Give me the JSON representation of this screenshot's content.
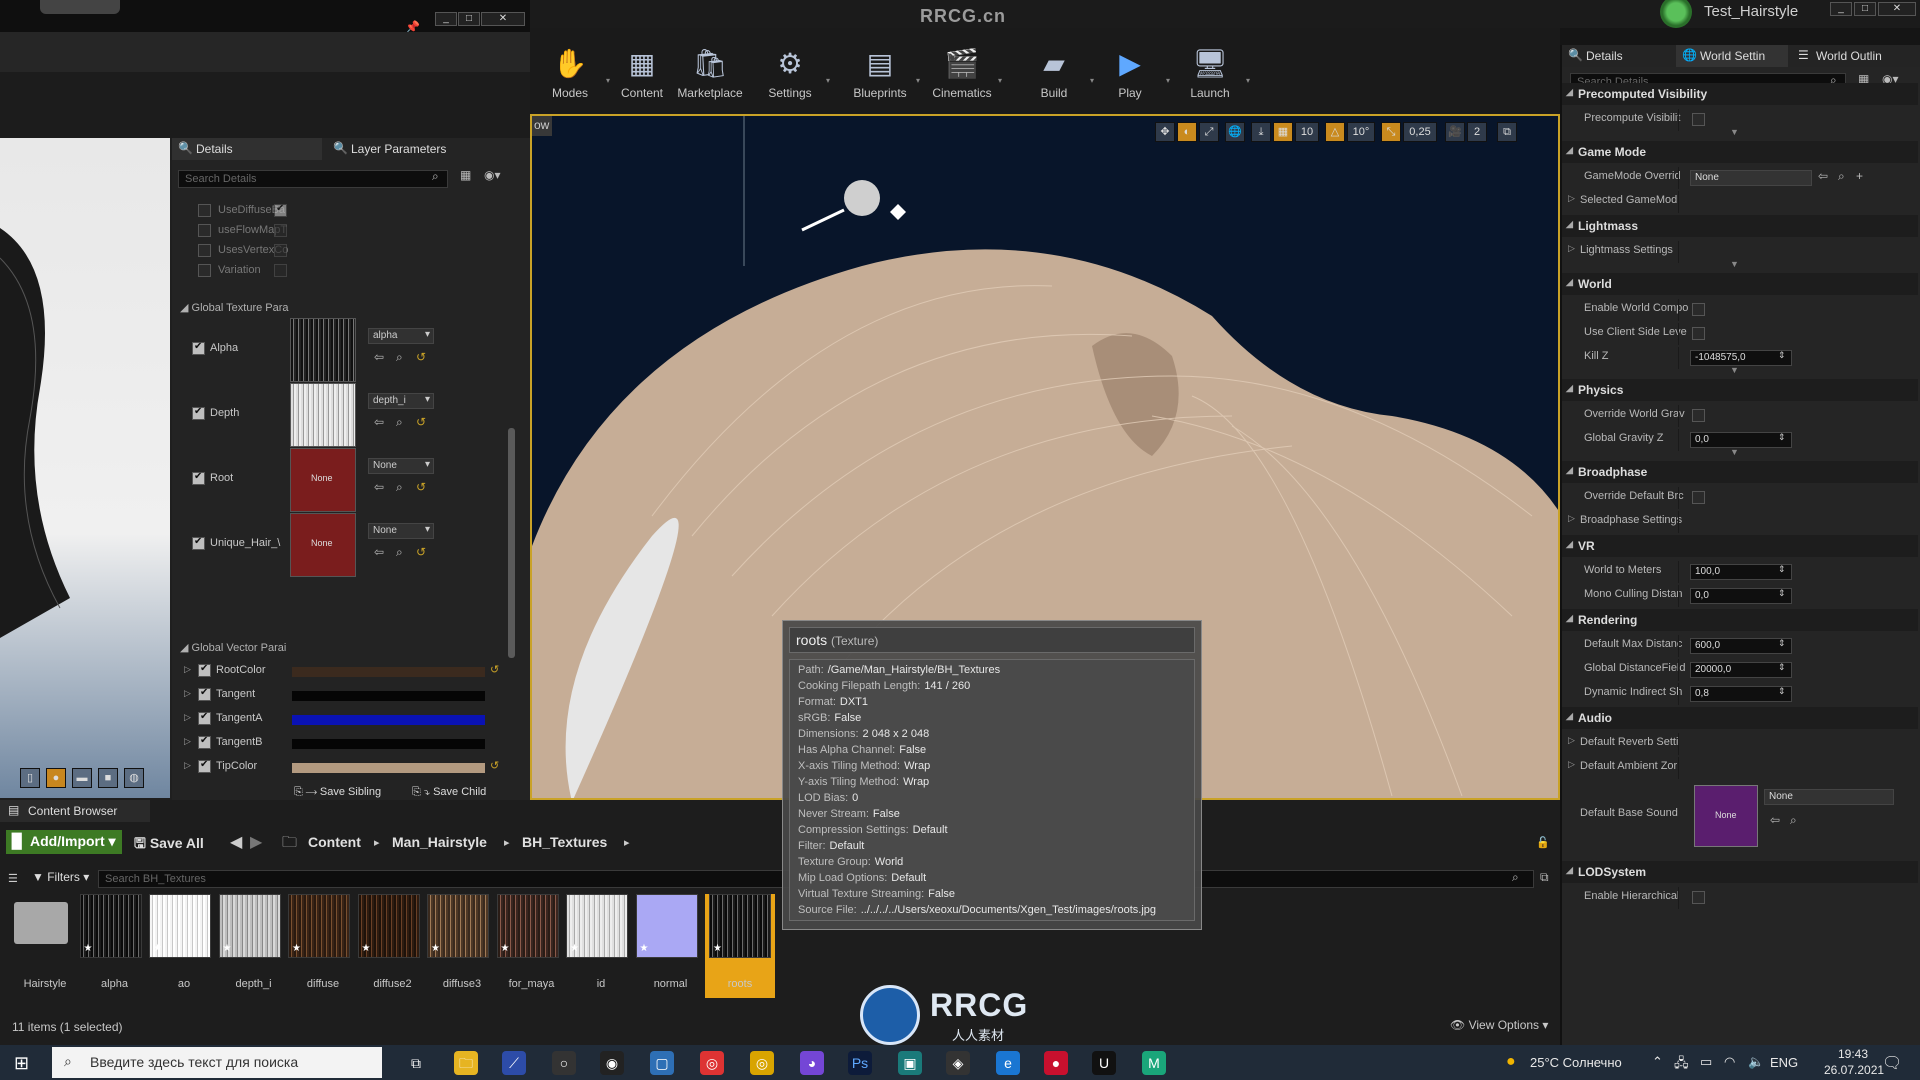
{
  "window": {
    "brand": "RRCG.cn",
    "project_name": "Test_Hairstyle"
  },
  "toolbar": {
    "buttons": [
      {
        "label": "Modes"
      },
      {
        "label": "Content"
      },
      {
        "label": "Marketplace"
      },
      {
        "label": "Settings"
      },
      {
        "label": "Blueprints"
      },
      {
        "label": "Cinematics"
      },
      {
        "label": "Build"
      },
      {
        "label": "Play"
      },
      {
        "label": "Launch"
      }
    ]
  },
  "viewport": {
    "corner_label": "ow",
    "grid_snap": "10",
    "rotation_snap": "10°",
    "scale_snap": "0,25",
    "camera_speed": "2"
  },
  "left_panel": {
    "tabs": [
      "Details",
      "Layer Parameters"
    ],
    "search_placeholder": "Search Details",
    "static_switches": [
      {
        "label": "UseDiffuseBa",
        "checked": true
      },
      {
        "label": "useFlowMapT",
        "checked": false
      },
      {
        "label": "UsesVertexCo",
        "checked": false
      },
      {
        "label": "Variation",
        "checked": false
      }
    ],
    "texture_group_label": "Global Texture Para",
    "textures": [
      {
        "label": "Alpha",
        "value": "alpha",
        "thumb": "hair-dark"
      },
      {
        "label": "Depth",
        "value": "depth_i",
        "thumb": "hair-light"
      },
      {
        "label": "Root",
        "value": "None",
        "thumb": "none"
      },
      {
        "label": "Unique_Hair_\\",
        "value": "None",
        "thumb": "none"
      }
    ],
    "none_label": "None",
    "vector_group_label": "Global Vector Parai",
    "vectors": [
      {
        "label": "RootColor",
        "color": "#3b2a1e"
      },
      {
        "label": "Tangent",
        "color": "#050505"
      },
      {
        "label": "TangentA",
        "color": "#0a12b4"
      },
      {
        "label": "TangentB",
        "color": "#050505"
      },
      {
        "label": "TipColor",
        "color": "#b39a80"
      }
    ],
    "save_sibling": "Save Sibling",
    "save_child": "Save Child"
  },
  "right_panel": {
    "tabs": [
      "Details",
      "World Settin",
      "World Outlin"
    ],
    "search_placeholder": "Search Details",
    "sections": [
      {
        "title": "Precomputed Visibility",
        "props": [
          {
            "label": "Precompute Visibilit",
            "kind": "check"
          }
        ]
      },
      {
        "title": "Game Mode",
        "props": [
          {
            "label": "GameMode Overrid",
            "kind": "select",
            "value": "None"
          },
          {
            "label": "Selected GameMod",
            "kind": "expand"
          }
        ]
      },
      {
        "title": "Lightmass",
        "props": [
          {
            "label": "Lightmass Settings",
            "kind": "expand"
          }
        ]
      },
      {
        "title": "World",
        "props": [
          {
            "label": "Enable World Compo",
            "kind": "check"
          },
          {
            "label": "Use Client Side Leve",
            "kind": "check"
          },
          {
            "label": "Kill Z",
            "kind": "num",
            "value": "-1048575,0"
          }
        ]
      },
      {
        "title": "Physics",
        "props": [
          {
            "label": "Override World Grav",
            "kind": "check"
          },
          {
            "label": "Global Gravity Z",
            "kind": "num",
            "value": "0,0"
          }
        ]
      },
      {
        "title": "Broadphase",
        "props": [
          {
            "label": "Override Default Brc",
            "kind": "check"
          },
          {
            "label": "Broadphase Settings",
            "kind": "expand"
          }
        ]
      },
      {
        "title": "VR",
        "props": [
          {
            "label": "World to Meters",
            "kind": "num",
            "value": "100,0"
          },
          {
            "label": "Mono Culling Distan",
            "kind": "num",
            "value": "0,0"
          }
        ]
      },
      {
        "title": "Rendering",
        "props": [
          {
            "label": "Default Max Distanc",
            "kind": "num",
            "value": "600,0"
          },
          {
            "label": "Global DistanceField",
            "kind": "num",
            "value": "20000,0"
          },
          {
            "label": "Dynamic Indirect Sh",
            "kind": "num",
            "value": "0,8"
          }
        ]
      },
      {
        "title": "Audio",
        "props": [
          {
            "label": "Default Reverb Setti",
            "kind": "expand"
          },
          {
            "label": "Default Ambient Zor",
            "kind": "expand"
          }
        ]
      },
      {
        "title": "LODSystem",
        "props": [
          {
            "label": "Enable Hierarchical",
            "kind": "check"
          }
        ]
      }
    ],
    "base_sound_label": "Default Base Sound",
    "base_sound_value": "None",
    "base_sound_thumb": "None"
  },
  "content_browser": {
    "tab": "Content Browser",
    "add_import": "Add/Import",
    "save_all": "Save All",
    "breadcrumb": [
      "Content",
      "Man_Hairstyle",
      "BH_Textures"
    ],
    "filters": "Filters",
    "search_placeholder": "Search BH_Textures",
    "assets": [
      {
        "name": "Hairstyle",
        "kind": "folder"
      },
      {
        "name": "alpha",
        "kind": "dark"
      },
      {
        "name": "ao",
        "kind": "white"
      },
      {
        "name": "depth_i",
        "kind": "light"
      },
      {
        "name": "diffuse",
        "kind": "brown"
      },
      {
        "name": "diffuse2",
        "kind": "brown2"
      },
      {
        "name": "diffuse3",
        "kind": "brown3"
      },
      {
        "name": "for_maya",
        "kind": "brown4"
      },
      {
        "name": "id",
        "kind": "grey"
      },
      {
        "name": "normal",
        "kind": "normal"
      },
      {
        "name": "roots",
        "kind": "dark",
        "selected": true
      }
    ],
    "status": "11 items (1 selected)",
    "view_options": "View Options"
  },
  "tooltip": {
    "title": "roots",
    "type": "(Texture)",
    "rows": [
      {
        "k": "Path:",
        "v": "/Game/Man_Hairstyle/BH_Textures"
      },
      {
        "k": "Cooking Filepath Length:",
        "v": "141 / 260"
      },
      {
        "k": "Format:",
        "v": "DXT1"
      },
      {
        "k": "sRGB:",
        "v": "False"
      },
      {
        "k": "Dimensions:",
        "v": "2 048 x 2 048"
      },
      {
        "k": "Has Alpha Channel:",
        "v": "False"
      },
      {
        "k": "X-axis Tiling Method:",
        "v": "Wrap"
      },
      {
        "k": "Y-axis Tiling Method:",
        "v": "Wrap"
      },
      {
        "k": "LOD Bias:",
        "v": "0"
      },
      {
        "k": "Never Stream:",
        "v": "False"
      },
      {
        "k": "Compression Settings:",
        "v": "Default"
      },
      {
        "k": "Filter:",
        "v": "Default"
      },
      {
        "k": "Texture Group:",
        "v": "World"
      },
      {
        "k": "Mip Load Options:",
        "v": "Default"
      },
      {
        "k": "Virtual Texture Streaming:",
        "v": "False"
      },
      {
        "k": "Source File:",
        "v": "../../../../Users/xeoxu/Documents/Xgen_Test/images/roots.jpg"
      }
    ]
  },
  "watermark": {
    "text": "RRCG",
    "sub": "人人素材"
  },
  "taskbar": {
    "search_placeholder": "Введите здесь текст для поиска",
    "weather": "25°C Солнечно",
    "lang": "ENG",
    "time": "19:43",
    "date": "26.07.2021"
  }
}
